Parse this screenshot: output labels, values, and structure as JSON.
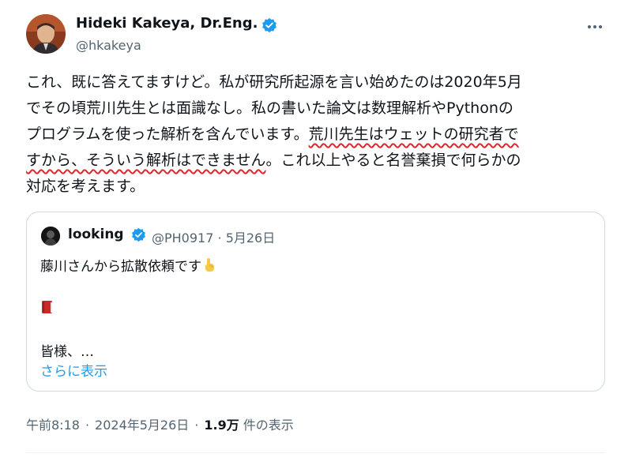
{
  "author": {
    "name": "Hideki Kakeya, Dr.Eng.",
    "handle": "@hkakeya",
    "verified_color": "#1d9bf0"
  },
  "body": {
    "line1": "これ、既に答えてますけど。私が研究所起源を言い始めたのは2020年5月",
    "line2": "でその頃荒川先生とは面識なし。私の書いた論文は数理解析やPythonの",
    "line3_plain": "プログラムを使った解析を含んでいます。",
    "line3_underlined": "荒川先生はウェットの研究者で",
    "line4_underlined": "すから、そういう解析はできません",
    "line4_plain": "。これ以上やると名誉棄損で何らかの",
    "line5": "対応を考えます。",
    "underline_color": "#e0262b"
  },
  "quote": {
    "name": "looking",
    "handle": "@PH0917",
    "separator": "·",
    "date": "5月26日",
    "line1": "藤川さんから拡散依頼です",
    "line3": "皆様、…",
    "show_more": "さらに表示",
    "icons": [
      "pointing-finger-icon",
      "book-icon"
    ]
  },
  "footer": {
    "time": "午前8:18",
    "date": "2024年5月26日",
    "views_count": "1.9万",
    "views_label": "件の表示",
    "separator": "·"
  },
  "colors": {
    "text": "#0f1419",
    "secondary": "#536471",
    "link": "#1d9bf0",
    "border": "#cfd9de"
  }
}
